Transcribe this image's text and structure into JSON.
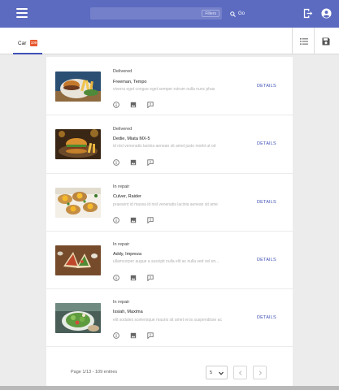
{
  "header": {
    "search_value": "",
    "filter_label": "Filters",
    "go_label": "Go"
  },
  "tabs": [
    {
      "label": "Car",
      "badge": "109"
    }
  ],
  "rows": [
    {
      "status": "Delivered",
      "title": "Freeman, Tempo",
      "description": "viverra eget congue eget semper rutrum nulla nunc phas",
      "action": "DETAILS"
    },
    {
      "status": "Delivered",
      "title": "Dedie, Miata MX-5",
      "description": "id nisl venenatis lacinia aenean sit amet justo morbi ut od",
      "action": "DETAILS"
    },
    {
      "status": "In repair",
      "title": "Culver, Raider",
      "description": "praesent id massa id nisl venenatis lacinia aenean sit ame",
      "action": "DETAILS"
    },
    {
      "status": "In repair",
      "title": "Addy, Impreza",
      "description": "ullamcorper augue a suscipit nulla elit ac nulla sed vel en...",
      "action": "DETAILS"
    },
    {
      "status": "In repair",
      "title": "Issiah, Maxima",
      "description": "elit sodales scelerisque mauris sit amet eros suspendisse ac",
      "action": "DETAILS"
    }
  ],
  "pagination": {
    "info": "Page 1/13 - 109 entries",
    "page_size": "5"
  },
  "colors": {
    "appbar": "#5c6bc0",
    "accent": "#3f51b5",
    "badge": "#e65a30"
  }
}
